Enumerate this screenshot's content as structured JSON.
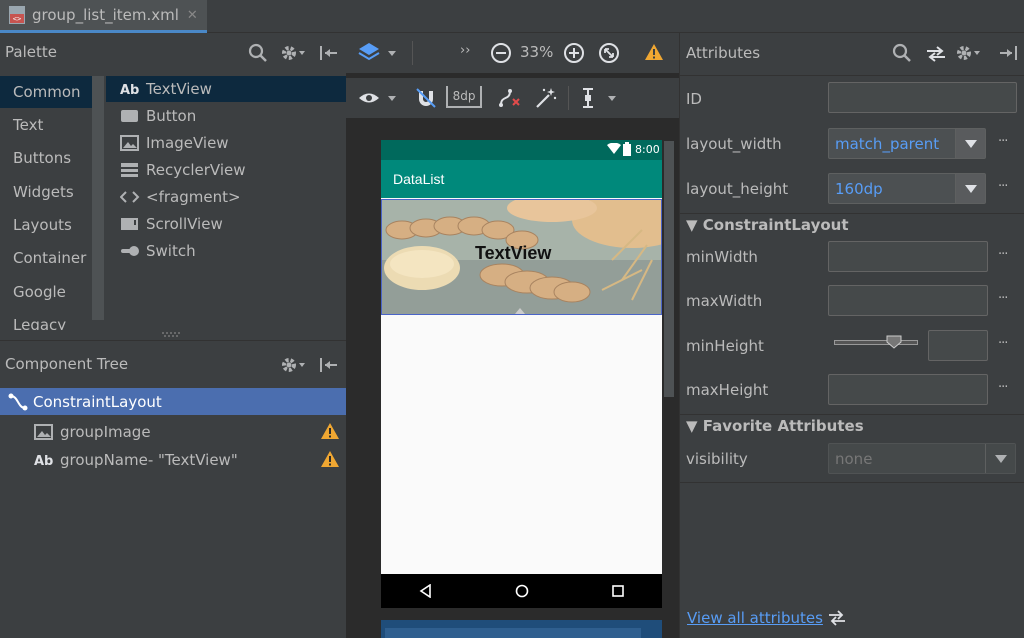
{
  "tab": {
    "filename": "group_list_item.xml"
  },
  "palette": {
    "title": "Palette",
    "categories": [
      "Common",
      "Text",
      "Buttons",
      "Widgets",
      "Layouts",
      "Container",
      "Google",
      "Legacy"
    ],
    "items": [
      {
        "label": "TextView",
        "icon": "textview-icon"
      },
      {
        "label": "Button",
        "icon": "button-icon"
      },
      {
        "label": "ImageView",
        "icon": "imageview-icon"
      },
      {
        "label": "RecyclerView",
        "icon": "recyclerview-icon"
      },
      {
        "label": "<fragment>",
        "icon": "fragment-icon"
      },
      {
        "label": "ScrollView",
        "icon": "scrollview-icon"
      },
      {
        "label": "Switch",
        "icon": "switch-icon"
      }
    ]
  },
  "tree": {
    "title": "Component Tree",
    "rows": [
      {
        "label": "ConstraintLayout"
      },
      {
        "label": "groupImage"
      },
      {
        "label": "groupName- \"TextView\""
      }
    ]
  },
  "design": {
    "zoom": "33%",
    "margin": "8dp",
    "phone": {
      "time": "8:00",
      "app_title": "DataList",
      "text_view": "TextView"
    }
  },
  "attributes": {
    "title": "Attributes",
    "id_label": "ID",
    "layout_width_label": "layout_width",
    "layout_width_value": "match_parent",
    "layout_height_label": "layout_height",
    "layout_height_value": "160dp",
    "section_constraint": "ConstraintLayout",
    "min_width": "minWidth",
    "max_width": "maxWidth",
    "min_height": "minHeight",
    "max_height": "maxHeight",
    "section_favorite": "Favorite Attributes",
    "visibility_label": "visibility",
    "visibility_value": "none",
    "view_all": "View all attributes",
    "dots": "···"
  },
  "colors": {
    "accent": "#4a88c7",
    "selection": "#4b6eaf",
    "palette_selection": "#0d293e",
    "app_bar": "#00897b",
    "status_bar": "#00695c",
    "link": "#589df6",
    "warning": "#f0a732"
  }
}
